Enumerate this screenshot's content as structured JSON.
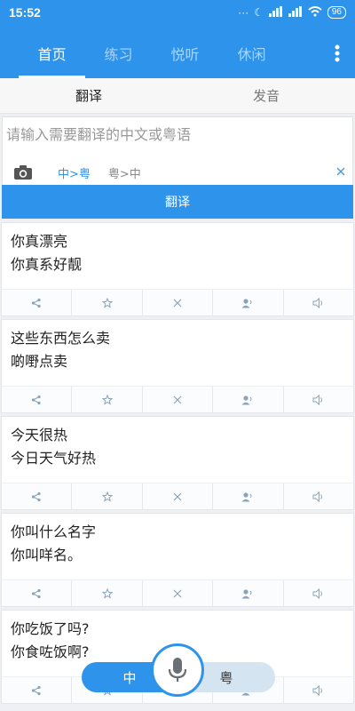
{
  "status": {
    "time": "15:52",
    "battery": "96"
  },
  "tabs": [
    {
      "label": "首页"
    },
    {
      "label": "练习"
    },
    {
      "label": "悦听"
    },
    {
      "label": "休闲"
    }
  ],
  "subtabs": [
    {
      "label": "翻译"
    },
    {
      "label": "发音"
    }
  ],
  "input": {
    "placeholder": "请输入需要翻译的中文或粤语",
    "dir_cn_to_yue": "中>粤",
    "dir_yue_to_cn": "粤>中",
    "translate_label": "翻译"
  },
  "cards": [
    {
      "src": "你真漂亮",
      "dst": "你真系好靓"
    },
    {
      "src": "这些东西怎么卖",
      "dst": "啲嘢点卖"
    },
    {
      "src": "今天很热",
      "dst": "今日天气好热"
    },
    {
      "src": "你叫什么名字",
      "dst": "你叫咩名。"
    },
    {
      "src": "你吃饭了吗?",
      "dst": "你食咗饭啊?"
    }
  ],
  "voice": {
    "left_label": "中",
    "right_label": "粤"
  },
  "colors": {
    "primary": "#2e93ea"
  },
  "icons": [
    "share-icon",
    "star-icon",
    "delete-icon",
    "speaker-person-icon",
    "volume-icon",
    "camera-icon",
    "mic-icon",
    "more-vert-icon"
  ]
}
